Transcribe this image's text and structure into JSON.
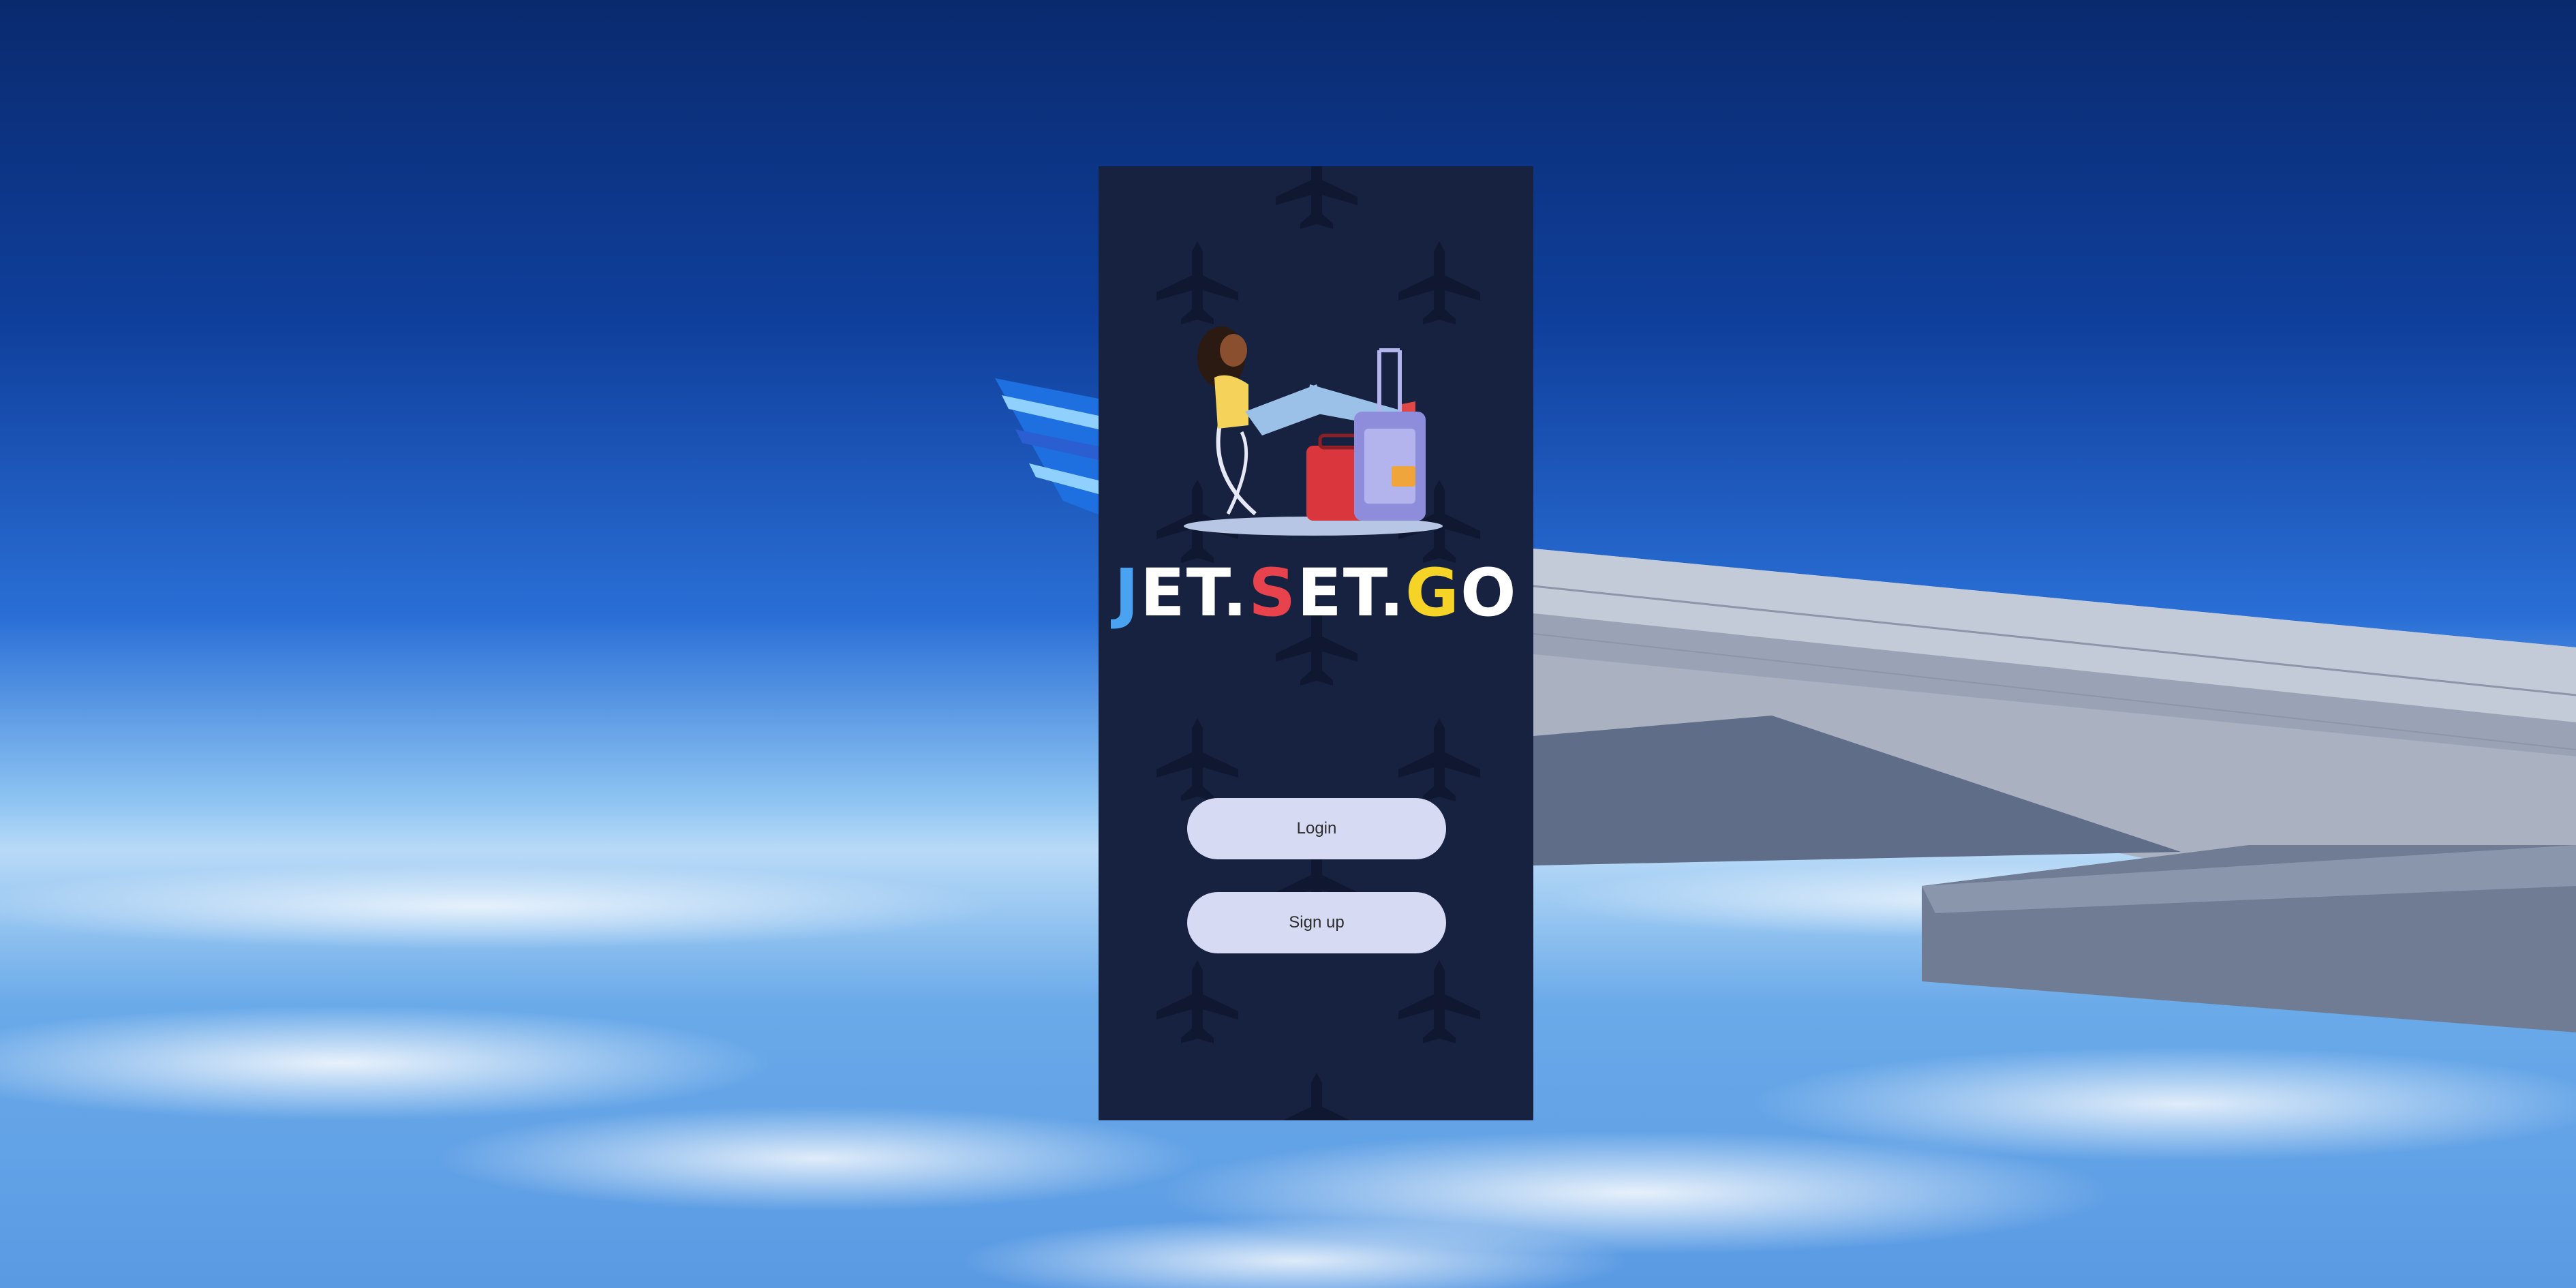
{
  "app": {
    "logo": {
      "part1": "J",
      "part2": "ET.",
      "part3": "S",
      "part4": "ET.",
      "part5": "G",
      "part6": "O"
    },
    "buttons": {
      "login_label": "Login",
      "signup_label": "Sign up"
    }
  },
  "colors": {
    "phone_background": "#172240",
    "button_background": "#d6daf2",
    "logo_j": "#4aa3f0",
    "logo_s": "#e8434c",
    "logo_g": "#f5d327"
  }
}
